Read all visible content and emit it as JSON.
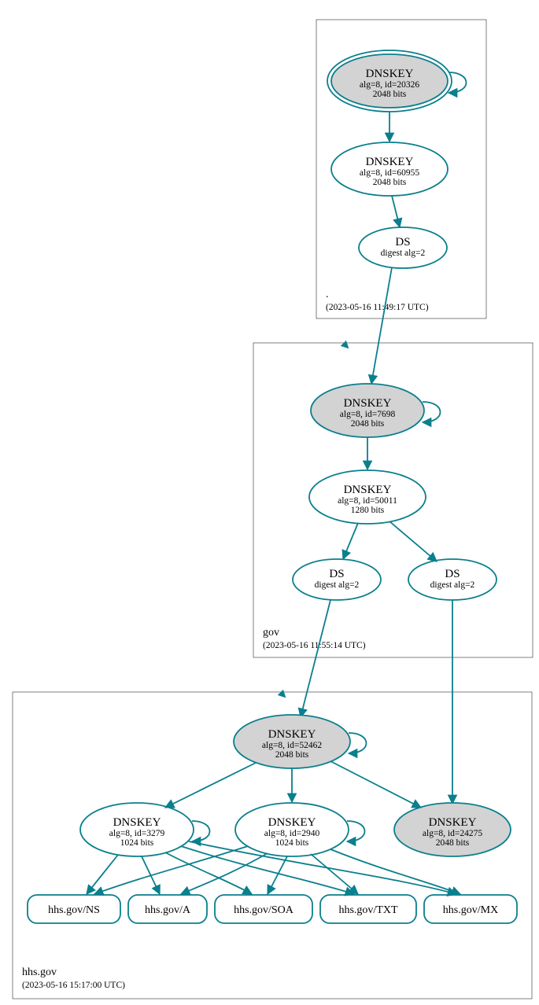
{
  "colors": {
    "stroke": "#0a7f8d",
    "shaded": "#d3d3d3"
  },
  "zones": {
    "root": {
      "label": ".",
      "time": "(2023-05-16 11:49:17 UTC)"
    },
    "gov": {
      "label": "gov",
      "time": "(2023-05-16 11:55:14 UTC)"
    },
    "hhs": {
      "label": "hhs.gov",
      "time": "(2023-05-16 15:17:00 UTC)"
    }
  },
  "nodes": {
    "root_ksk": {
      "title": "DNSKEY",
      "line1": "alg=8, id=20326",
      "line2": "2048 bits"
    },
    "root_zsk": {
      "title": "DNSKEY",
      "line1": "alg=8, id=60955",
      "line2": "2048 bits"
    },
    "root_ds": {
      "title": "DS",
      "line1": "digest alg=2",
      "line2": ""
    },
    "gov_ksk": {
      "title": "DNSKEY",
      "line1": "alg=8, id=7698",
      "line2": "2048 bits"
    },
    "gov_zsk": {
      "title": "DNSKEY",
      "line1": "alg=8, id=50011",
      "line2": "1280 bits"
    },
    "gov_ds1": {
      "title": "DS",
      "line1": "digest alg=2",
      "line2": ""
    },
    "gov_ds2": {
      "title": "DS",
      "line1": "digest alg=2",
      "line2": ""
    },
    "hhs_ksk": {
      "title": "DNSKEY",
      "line1": "alg=8, id=52462",
      "line2": "2048 bits"
    },
    "hhs_zsk1": {
      "title": "DNSKEY",
      "line1": "alg=8, id=3279",
      "line2": "1024 bits"
    },
    "hhs_zsk2": {
      "title": "DNSKEY",
      "line1": "alg=8, id=2940",
      "line2": "1024 bits"
    },
    "hhs_extra": {
      "title": "DNSKEY",
      "line1": "alg=8, id=24275",
      "line2": "2048 bits"
    }
  },
  "rr": {
    "ns": "hhs.gov/NS",
    "a": "hhs.gov/A",
    "soa": "hhs.gov/SOA",
    "txt": "hhs.gov/TXT",
    "mx": "hhs.gov/MX"
  }
}
